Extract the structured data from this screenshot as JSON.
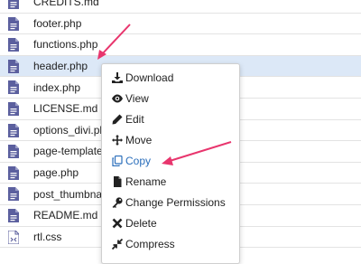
{
  "files": [
    {
      "name": "CREDITS.md",
      "type": "text"
    },
    {
      "name": "footer.php",
      "type": "text"
    },
    {
      "name": "functions.php",
      "type": "text"
    },
    {
      "name": "header.php",
      "type": "text",
      "selected": true
    },
    {
      "name": "index.php",
      "type": "text"
    },
    {
      "name": "LICENSE.md",
      "type": "text"
    },
    {
      "name": "options_divi.ph",
      "type": "text"
    },
    {
      "name": "page-template",
      "type": "text"
    },
    {
      "name": "page.php",
      "type": "text"
    },
    {
      "name": "post_thumbnai",
      "type": "text"
    },
    {
      "name": "README.md",
      "type": "text"
    },
    {
      "name": "rtl.css",
      "type": "css"
    }
  ],
  "context_menu": {
    "items": [
      {
        "label": "Download",
        "icon": "download-icon"
      },
      {
        "label": "View",
        "icon": "eye-icon"
      },
      {
        "label": "Edit",
        "icon": "pencil-icon"
      },
      {
        "label": "Move",
        "icon": "move-icon"
      },
      {
        "label": "Copy",
        "icon": "copy-icon",
        "highlight_color": "#2a6ebb"
      },
      {
        "label": "Rename",
        "icon": "file-icon"
      },
      {
        "label": "Change Permissions",
        "icon": "key-icon"
      },
      {
        "label": "Delete",
        "icon": "close-icon"
      },
      {
        "label": "Compress",
        "icon": "compress-icon"
      }
    ]
  },
  "colors": {
    "file_icon": "#5b5f9e",
    "selected_row": "#dce8f7",
    "arrow": "#e8356d"
  }
}
